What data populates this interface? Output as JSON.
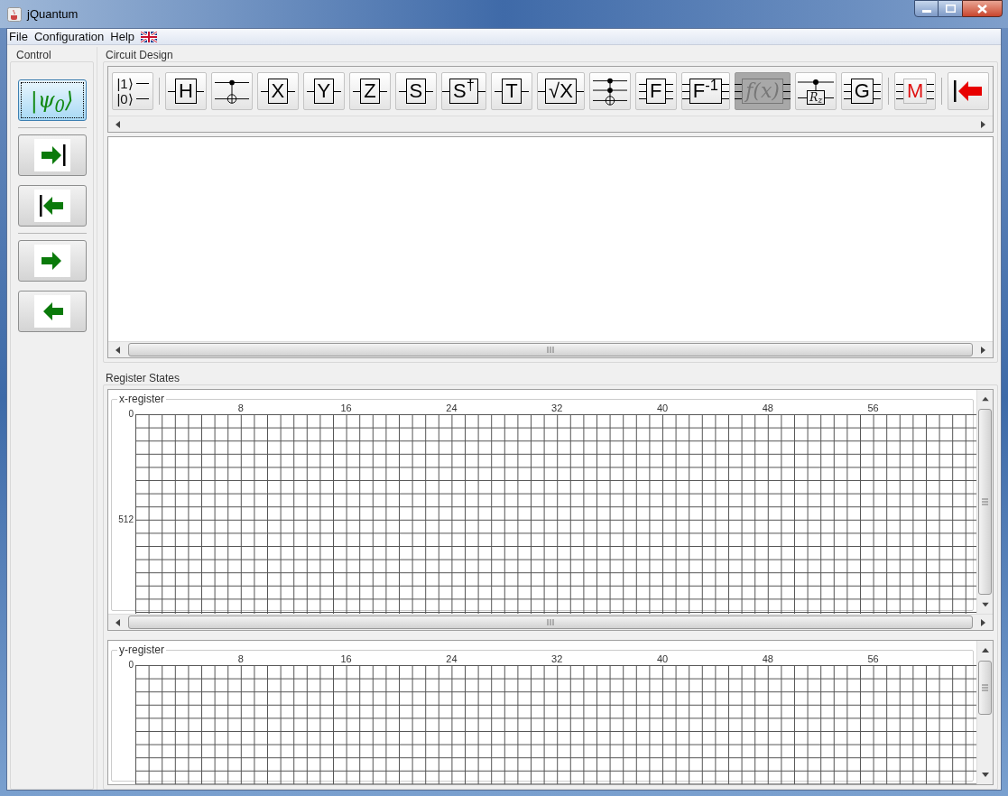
{
  "window": {
    "title": "jQuantum"
  },
  "menu": [
    {
      "label": "File"
    },
    {
      "label": "Configuration"
    },
    {
      "label": "Help"
    }
  ],
  "control": {
    "title": "Control",
    "groups": [
      [
        {
          "kind": "state",
          "label": "|ψ$_{0}$⟩",
          "focused": true
        }
      ],
      [
        {
          "kind": "run-end",
          "focused": false
        },
        {
          "kind": "back-start",
          "focused": false
        }
      ],
      [
        {
          "kind": "step-forward",
          "focused": false
        },
        {
          "kind": "step-back",
          "focused": false
        }
      ]
    ]
  },
  "circuit": {
    "title": "Circuit Design",
    "toolbar": [
      [
        {
          "kind": "init",
          "label": "|1⟩",
          "label2": "|0⟩",
          "disabled": false
        }
      ],
      [
        {
          "kind": "single",
          "label": "H",
          "disabled": false
        },
        {
          "kind": "cnot",
          "disabled": false
        },
        {
          "kind": "single",
          "label": "X",
          "disabled": false
        },
        {
          "kind": "single",
          "label": "Y",
          "disabled": false
        },
        {
          "kind": "single",
          "label": "Z",
          "disabled": false
        },
        {
          "kind": "single",
          "label": "S",
          "disabled": false
        },
        {
          "kind": "single",
          "label": "S$^{†}$",
          "disabled": false
        },
        {
          "kind": "single",
          "label": "T",
          "disabled": false
        },
        {
          "kind": "single",
          "label": "√X",
          "disabled": false
        },
        {
          "kind": "toffoli",
          "disabled": false
        },
        {
          "kind": "multi",
          "label": "F",
          "disabled": false
        },
        {
          "kind": "multi",
          "label": "F$^{-1}$",
          "disabled": false
        },
        {
          "kind": "oracle",
          "label": "f(x)",
          "disabled": true
        },
        {
          "kind": "controlled",
          "label": "R$_{z}$",
          "disabled": false
        },
        {
          "kind": "multi",
          "label": "G",
          "disabled": false
        }
      ],
      [
        {
          "kind": "measure",
          "label": "M",
          "disabled": false
        }
      ],
      [
        {
          "kind": "undo",
          "disabled": false
        }
      ]
    ]
  },
  "registers": {
    "title": "Register States",
    "panels": [
      {
        "title": "x-register",
        "column_labels": [
          "8",
          "16",
          "24",
          "32",
          "40",
          "48",
          "56"
        ],
        "row_labels": [
          "0",
          "512"
        ]
      },
      {
        "title": "y-register",
        "column_labels": [
          "8",
          "16",
          "24",
          "32",
          "40",
          "48",
          "56"
        ],
        "row_labels": [
          "0"
        ]
      }
    ]
  }
}
